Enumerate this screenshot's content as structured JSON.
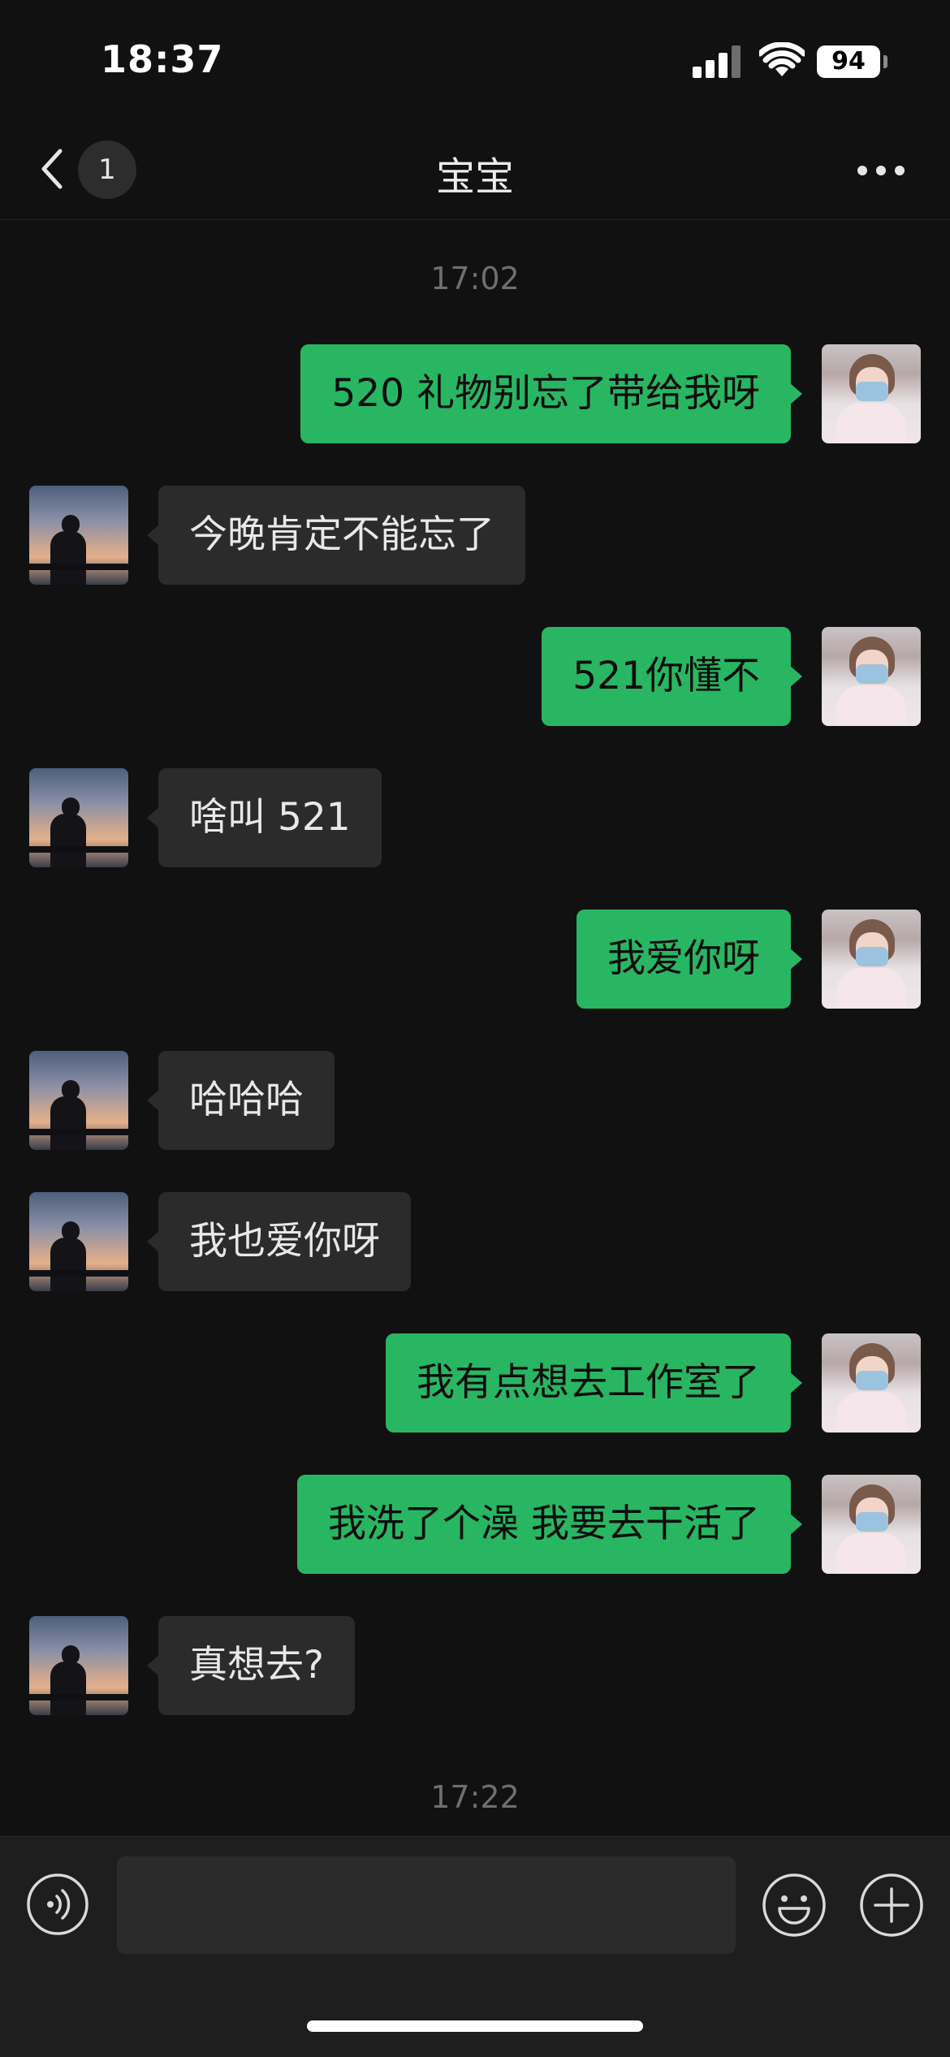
{
  "status_bar": {
    "time": "18:37",
    "battery": "94"
  },
  "nav": {
    "unread_count": "1",
    "title": "宝宝"
  },
  "chat": {
    "timestamps": [
      "17:02",
      "17:22"
    ],
    "messages": [
      {
        "from": "me",
        "text": "520 礼物别忘了带给我呀"
      },
      {
        "from": "them",
        "text": "今晚肯定不能忘了"
      },
      {
        "from": "me",
        "text": "521你懂不"
      },
      {
        "from": "them",
        "text": "啥叫 521"
      },
      {
        "from": "me",
        "text": "我爱你呀"
      },
      {
        "from": "them",
        "text": "哈哈哈"
      },
      {
        "from": "them",
        "text": "我也爱你呀"
      },
      {
        "from": "me",
        "text": "我有点想去工作室了"
      },
      {
        "from": "me",
        "text": "我洗了个澡 我要去干活了"
      },
      {
        "from": "them",
        "text": "真想去?"
      }
    ]
  },
  "input_bar": {
    "value": "",
    "placeholder": ""
  },
  "colors": {
    "sent_bubble": "#29b662",
    "received_bubble": "#2b2b2b",
    "background": "#111111"
  },
  "icons": [
    "back-icon",
    "more-icon",
    "voice-icon",
    "emoji-icon",
    "plus-icon"
  ]
}
